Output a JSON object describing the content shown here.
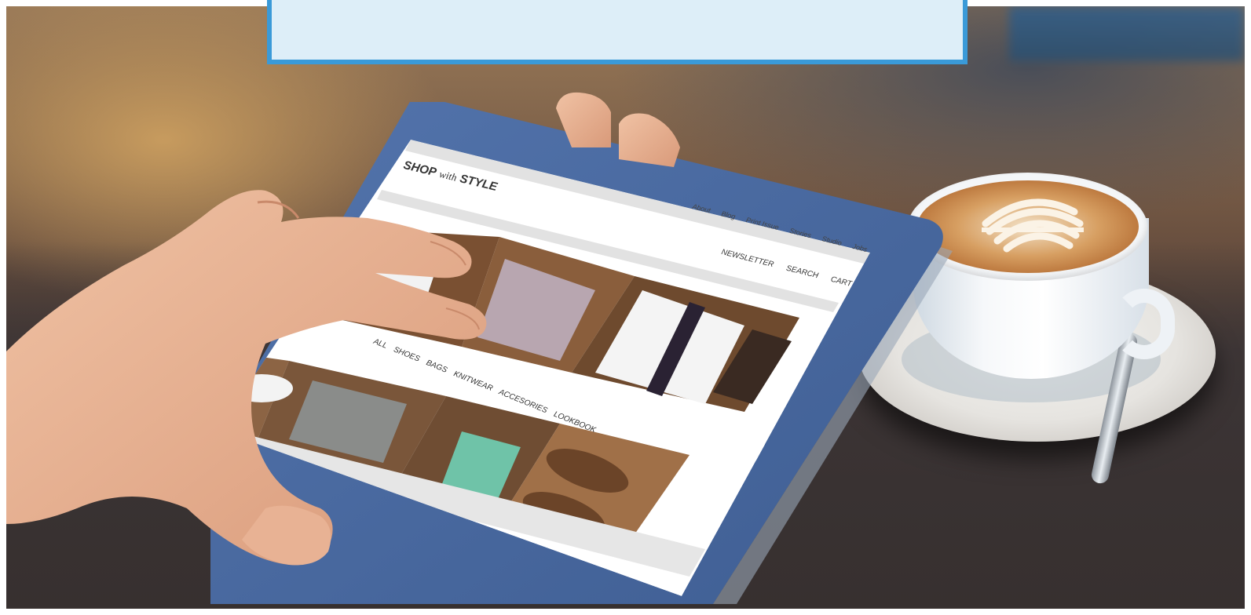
{
  "header_box": {
    "text": ""
  },
  "shop": {
    "logo_shop": "SHOP",
    "logo_with": "with",
    "logo_style": "STYLE",
    "top_links": [
      "About",
      "Blog",
      "Print Issue",
      "Stories",
      "Studio",
      "Jobs"
    ],
    "actions": [
      "NEWSLETTER",
      "SEARCH",
      "CART"
    ],
    "categories": [
      "ALL",
      "SHOES",
      "BAGS",
      "KNITWEAR",
      "ACCESORIES",
      "LOOKBOOK"
    ]
  },
  "colors": {
    "header_border": "#3a9ad8",
    "header_fill": "#ddeef8",
    "tablet_frame": "#4a6aa0",
    "screen_bg": "#ffffff"
  },
  "products_row1": [
    {
      "icon": "white-shirt-photo"
    },
    {
      "icon": "striped-shirt-photo"
    },
    {
      "icon": "shirt-tie-watch-photo"
    }
  ],
  "products_row2": [
    {
      "icon": "sneakers-photo"
    },
    {
      "icon": "denim-shorts-photo"
    },
    {
      "icon": "crochet-top-sunglasses-photo"
    },
    {
      "icon": "brown-shoes-photo"
    }
  ]
}
